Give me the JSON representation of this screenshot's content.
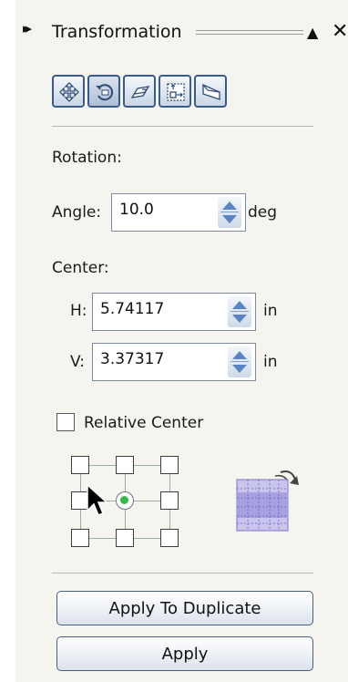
{
  "header": {
    "title": "Transformation",
    "expand_glyph": "▸▸",
    "collapse_glyph": "▲",
    "close_glyph": "✕"
  },
  "toolbar": {
    "tools": [
      {
        "name": "position-icon",
        "active": false
      },
      {
        "name": "rotate-icon",
        "active": true
      },
      {
        "name": "scale-mirror-icon",
        "active": false
      },
      {
        "name": "size-icon",
        "active": false
      },
      {
        "name": "skew-icon",
        "active": false
      }
    ]
  },
  "rotation": {
    "section_label": "Rotation:",
    "angle_label": "Angle:",
    "angle_value": "10.0",
    "angle_unit": "deg"
  },
  "center": {
    "section_label": "Center:",
    "h_label": "H:",
    "h_value": "5.74117",
    "h_unit": "in",
    "v_label": "V:",
    "v_value": "3.37317",
    "v_unit": "in"
  },
  "relative_center": {
    "label": "Relative Center",
    "checked": false
  },
  "anchor": {
    "selected": "middle-center"
  },
  "buttons": {
    "apply_to_duplicate": "Apply To Duplicate",
    "apply": "Apply"
  }
}
